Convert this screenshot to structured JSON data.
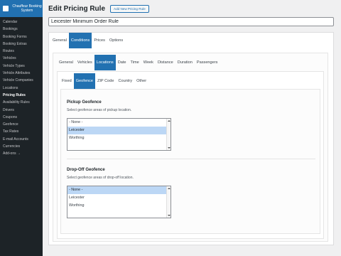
{
  "sidebar": {
    "title": "Chauffeur Booking System",
    "items": [
      {
        "label": "Calendar",
        "active": false
      },
      {
        "label": "Bookings",
        "active": false
      },
      {
        "label": "Booking Forms",
        "active": false
      },
      {
        "label": "Booking Extras",
        "active": false
      },
      {
        "label": "Routes",
        "active": false
      },
      {
        "label": "Vehicles",
        "active": false
      },
      {
        "label": "Vehicle Types",
        "active": false
      },
      {
        "label": "Vehicle Attributes",
        "active": false
      },
      {
        "label": "Vehicle Companies",
        "active": false
      },
      {
        "label": "Locations",
        "active": false
      },
      {
        "label": "Pricing Rules",
        "active": true
      },
      {
        "label": "Availability Rules",
        "active": false
      },
      {
        "label": "Drivers",
        "active": false
      },
      {
        "label": "Coupons",
        "active": false
      },
      {
        "label": "Geofence",
        "active": false
      },
      {
        "label": "Tax Rates",
        "active": false
      },
      {
        "label": "E-mail Accounts",
        "active": false
      },
      {
        "label": "Currencies",
        "active": false
      },
      {
        "label": "Add-ons →",
        "active": false
      }
    ]
  },
  "header": {
    "title": "Edit Pricing Rule",
    "add_button": "Add New Pricing Rule"
  },
  "rule_title": {
    "value": "Leicester Minimum Order Rule"
  },
  "tabs_level1": [
    {
      "label": "General",
      "active": false
    },
    {
      "label": "Conditions",
      "active": true
    },
    {
      "label": "Prices",
      "active": false
    },
    {
      "label": "Options",
      "active": false
    }
  ],
  "tabs_level2": [
    {
      "label": "General",
      "active": false
    },
    {
      "label": "Vehicles",
      "active": false
    },
    {
      "label": "Locations",
      "active": true
    },
    {
      "label": "Date",
      "active": false
    },
    {
      "label": "Time",
      "active": false
    },
    {
      "label": "Week",
      "active": false
    },
    {
      "label": "Distance",
      "active": false
    },
    {
      "label": "Duration",
      "active": false
    },
    {
      "label": "Passengers",
      "active": false
    }
  ],
  "tabs_level3": [
    {
      "label": "Fixed",
      "active": false
    },
    {
      "label": "Geofence",
      "active": true
    },
    {
      "label": "ZIP Code",
      "active": false
    },
    {
      "label": "Country",
      "active": false
    },
    {
      "label": "Other",
      "active": false
    }
  ],
  "pickup": {
    "title": "Pickup Geofence",
    "description": "Select geofence areas of pickup location.",
    "options": [
      {
        "label": "- None -",
        "selected": false
      },
      {
        "label": "Leicester",
        "selected": true
      },
      {
        "label": "Worthing",
        "selected": false
      }
    ]
  },
  "dropoff": {
    "title": "Drop-Off Geofence",
    "description": "Select geofence areas of drop-off location.",
    "options": [
      {
        "label": "- None -",
        "selected": true
      },
      {
        "label": "Leicester",
        "selected": false
      },
      {
        "label": "Worthing",
        "selected": false
      }
    ]
  },
  "colors": {
    "accent": "#2271b1",
    "sidebar_bg": "#1d2327",
    "selected_option": "#bcd7f5"
  }
}
